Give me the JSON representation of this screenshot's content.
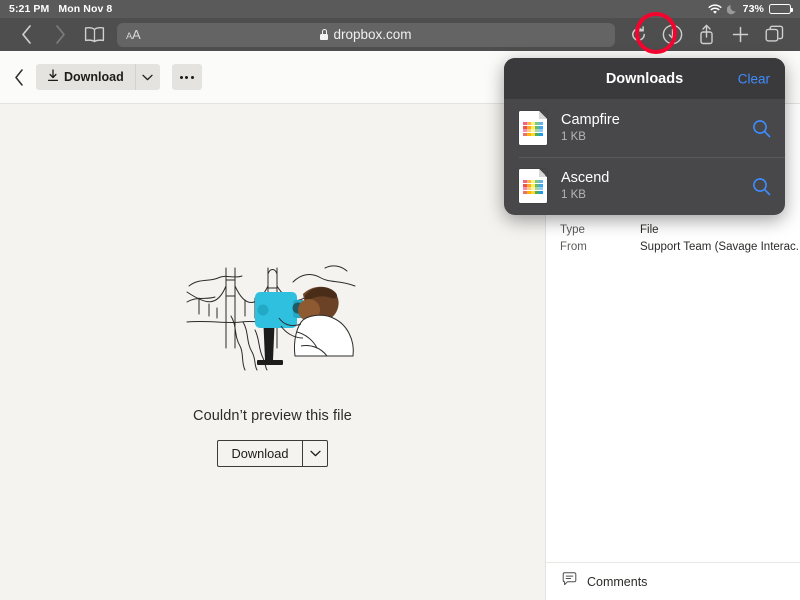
{
  "status_bar": {
    "time": "5:21 PM",
    "date": "Mon Nov 8",
    "wifi_icon": "wifi-icon",
    "dnd_icon": "crescent-moon-icon",
    "battery_percent": "73%",
    "battery_level": 73
  },
  "browser": {
    "back_icon": "chevron-left-icon",
    "forward_icon": "chevron-right-icon",
    "bookmarks_icon": "book-icon",
    "text_size_label": "AA",
    "lock_icon": "lock-icon",
    "url": "dropbox.com",
    "reload_icon": "reload-icon",
    "downloads_icon": "download-circle-icon",
    "share_icon": "share-icon",
    "new_tab_icon": "plus-icon",
    "tabs_icon": "tabs-icon",
    "highlight_color": "#f2062f"
  },
  "dropbox_toolbar": {
    "back_icon": "chevron-left-icon",
    "download_label": "Download",
    "download_icon": "download-arrow-icon",
    "caret_icon": "chevron-down-icon",
    "more_icon": "ellipsis-icon"
  },
  "preview": {
    "illustration_name": "person-with-viewfinder-illustration",
    "message": "Couldn’t preview this file",
    "download_label": "Download",
    "caret_icon": "chevron-down-icon"
  },
  "sidebar": {
    "metadata": [
      {
        "key": "Type",
        "value": "File"
      },
      {
        "key": "From",
        "value": "Support Team (Savage Interac..."
      }
    ],
    "comments_icon": "comment-bubble-icon",
    "comments_label": "Comments"
  },
  "downloads_popover": {
    "title": "Downloads",
    "clear_label": "Clear",
    "items": [
      {
        "name": "Campfire",
        "size": "1 KB",
        "file_icon": "spreadsheet-file-icon",
        "search_icon": "magnifier-icon"
      },
      {
        "name": "Ascend",
        "size": "1 KB",
        "file_icon": "spreadsheet-file-icon",
        "search_icon": "magnifier-icon"
      }
    ],
    "accent_color": "#3f8cff"
  }
}
